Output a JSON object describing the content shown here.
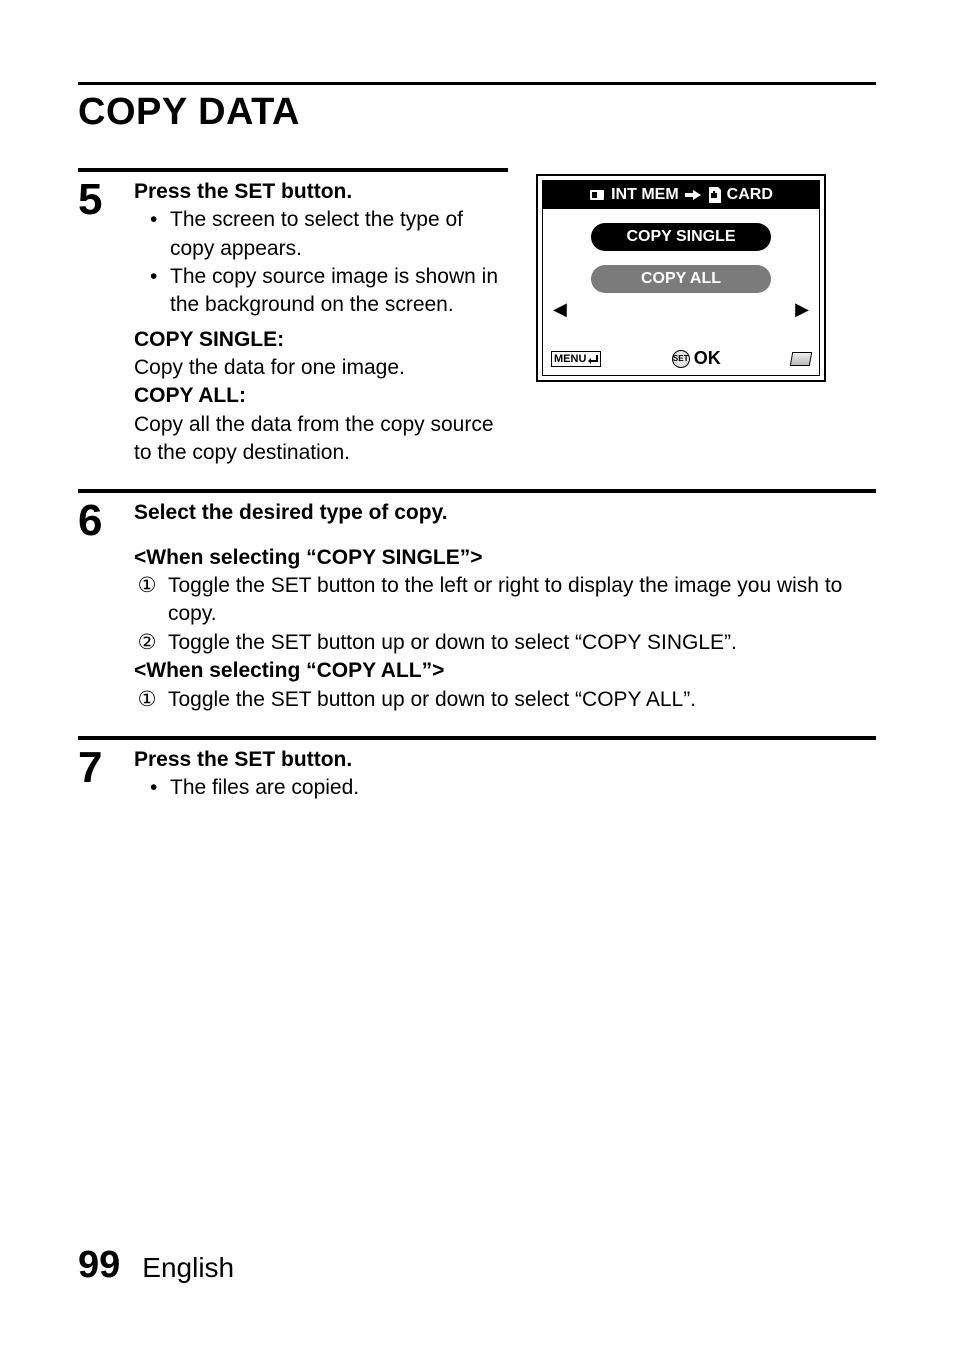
{
  "page": {
    "title": "COPY DATA",
    "number": "99",
    "language": "English"
  },
  "step5": {
    "number": "5",
    "heading": "Press the SET button.",
    "bullet1": "The screen to select the type of copy appears.",
    "bullet2": "The copy source image is shown in the background on the screen.",
    "def1_label": "COPY SINGLE:",
    "def1_text": "Copy the data for one image.",
    "def2_label": "COPY ALL:",
    "def2_text": "Copy all the data from the copy source to the copy destination."
  },
  "lcd": {
    "header_left": "INT MEM",
    "header_right": "CARD",
    "option1": "COPY SINGLE",
    "option2": "COPY ALL",
    "menu_label": "MENU",
    "set_label": "SET",
    "ok_label": "OK"
  },
  "step6": {
    "number": "6",
    "heading": "Select the desired type of copy.",
    "sub1": "<When selecting “COPY SINGLE”>",
    "sub1_item1": "Toggle the SET button to the left or right to display the image you wish to copy.",
    "sub1_item2": "Toggle the SET button up or down to select “COPY SINGLE”.",
    "sub2": "<When selecting “COPY ALL”>",
    "sub2_item1": "Toggle the SET button up or down to select “COPY ALL”."
  },
  "step7": {
    "number": "7",
    "heading": "Press the SET button.",
    "bullet1": "The files are copied."
  },
  "glyph": {
    "circ1": "①",
    "circ2": "②",
    "bullet": "•",
    "tri_left": "◀",
    "tri_right": "▶",
    "back": "↵"
  }
}
